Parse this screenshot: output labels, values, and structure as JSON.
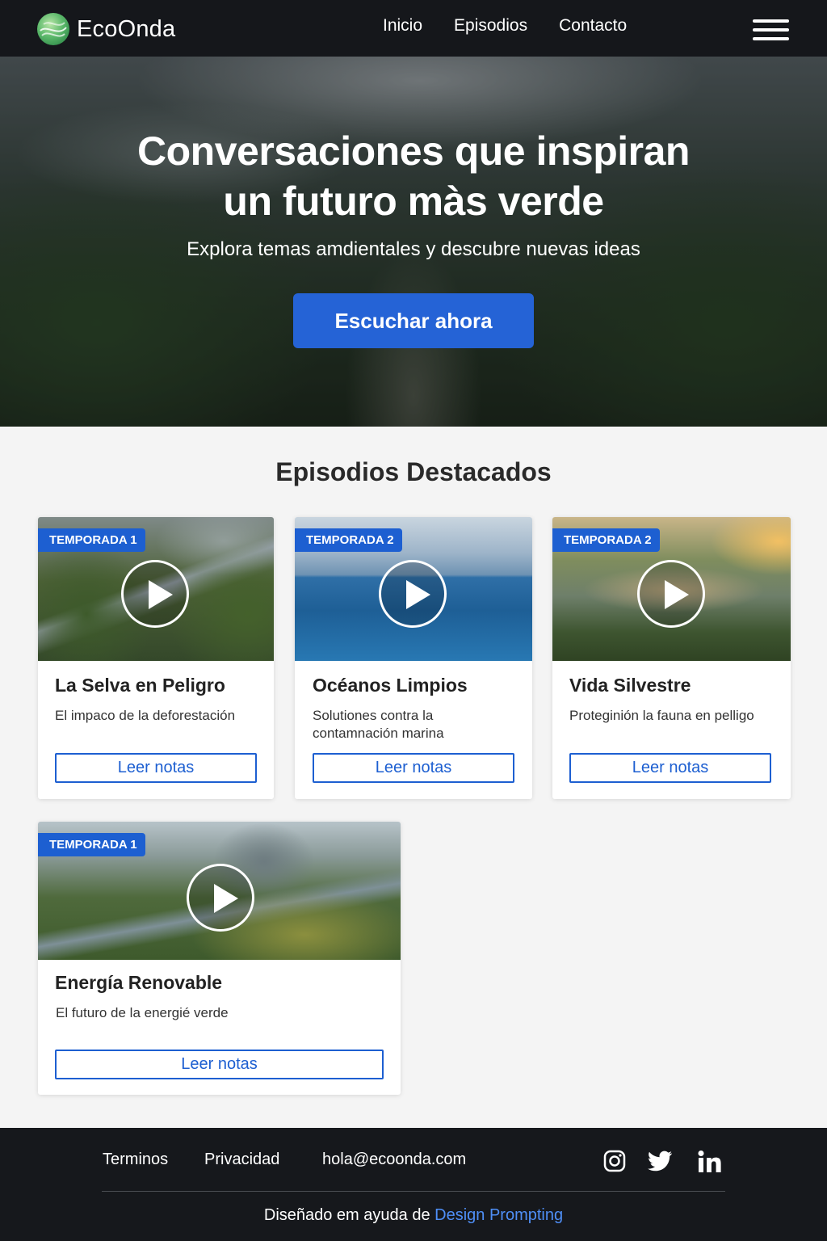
{
  "header": {
    "logo_text": "EcoOnda",
    "nav": [
      "Inicio",
      "Episodios",
      "Contacto"
    ]
  },
  "hero": {
    "title_line1": "Conversaciones que inspiran",
    "title_line2": "un futuro màs verde",
    "subtitle": "Explora temas amdientales y descubre nuevas ideas",
    "cta_label": "Escuchar ahora"
  },
  "section": {
    "title": "Episodios Destacados"
  },
  "episodes": [
    {
      "badge": "TEMPORADA 1",
      "title": "La Selva en Peligro",
      "desc": "El impaco de la deforestación",
      "button": "Leer notas"
    },
    {
      "badge": "TEMPORADA 2",
      "title": "Océanos Limpios",
      "desc": "Solutiones contra la contamnación marina",
      "button": "Leer notas"
    },
    {
      "badge": "TEMPORADA 2",
      "title": "Vida Silvestre",
      "desc": "Proteginión la fauna en pelligo",
      "button": "Leer notas"
    },
    {
      "badge": "TEMPORADA 1",
      "title": "Energía Renovable",
      "desc": "El futuro de la energié verde",
      "button": "Leer notas"
    }
  ],
  "footer": {
    "links": [
      "Terminos",
      "Privacidad",
      "hola@ecoonda.com"
    ],
    "social_icons": [
      "instagram-icon",
      "twitter-icon",
      "linkedin-icon"
    ],
    "credit_prefix": "Diseñado em ayuda de",
    "credit_brand": "Design Prompting"
  },
  "colors": {
    "accent": "#2563d6",
    "header_bg": "#15171b",
    "footer_bg": "#16181c",
    "link_brand": "#4f8ff7"
  }
}
